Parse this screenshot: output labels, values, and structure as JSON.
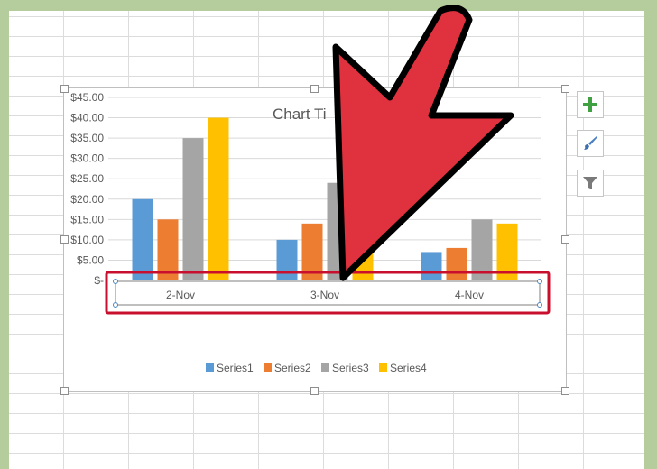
{
  "chart_data": {
    "type": "bar",
    "title": "Chart Ti",
    "categories": [
      "2-Nov",
      "3-Nov",
      "4-Nov"
    ],
    "series": [
      {
        "name": "Series1",
        "color": "#5b9bd5",
        "values": [
          20,
          10,
          7
        ]
      },
      {
        "name": "Series2",
        "color": "#ed7d31",
        "values": [
          15,
          14,
          8
        ]
      },
      {
        "name": "Series3",
        "color": "#a5a5a5",
        "values": [
          35,
          24,
          15
        ]
      },
      {
        "name": "Series4",
        "color": "#ffc000",
        "values": [
          40,
          10,
          14
        ]
      }
    ],
    "ylim": [
      0,
      45
    ],
    "ytick_labels": [
      "$-",
      "$5.00",
      "$10.00",
      "$15.00",
      "$20.00",
      "$25.00",
      "$30.00",
      "$35.00",
      "$40.00",
      "$45.00"
    ],
    "grid": true,
    "legend_position": "bottom"
  },
  "colors": {
    "highlight": "#c8102e",
    "arrow_fill": "#e0313f",
    "arrow_outline": "#000000"
  },
  "icons": {
    "add": "plus-icon",
    "style": "paintbrush-icon",
    "filter": "funnel-icon"
  }
}
